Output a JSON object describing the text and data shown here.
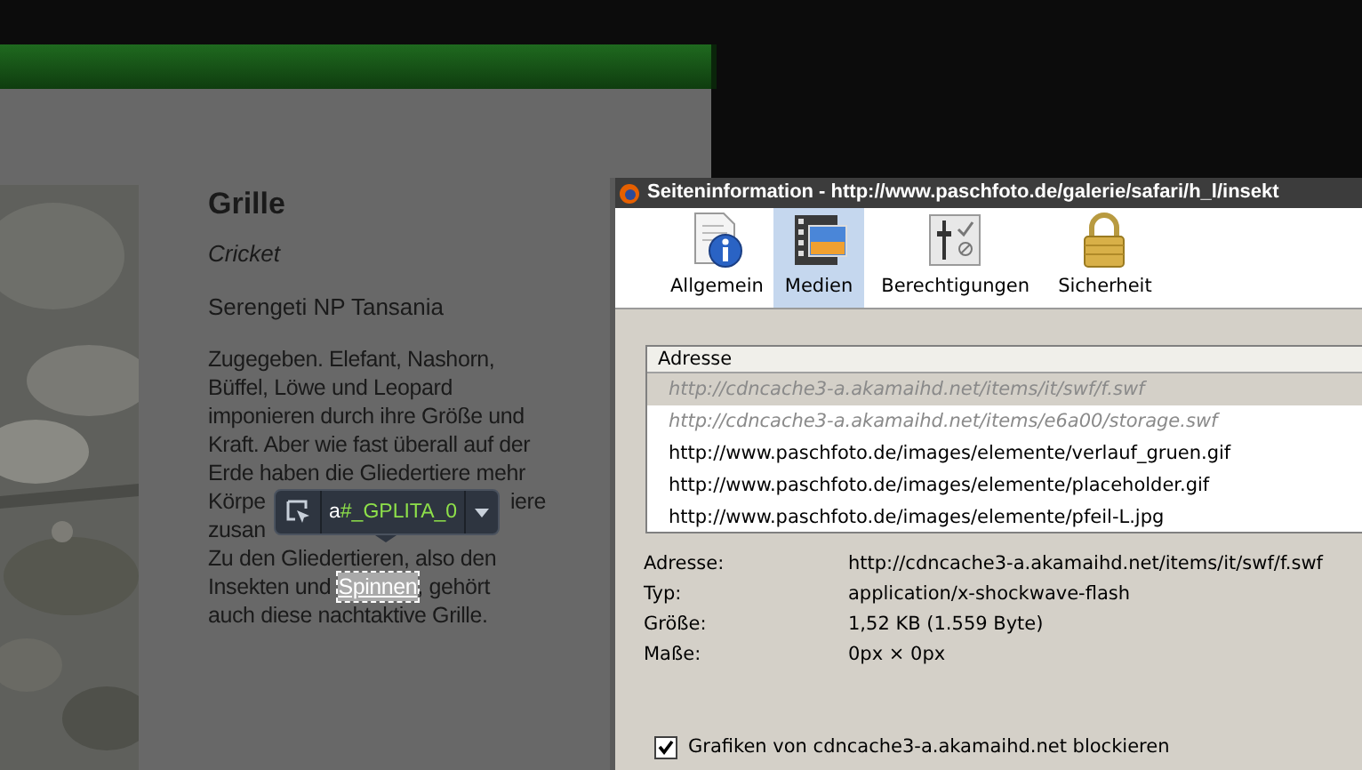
{
  "page": {
    "title": "Grille",
    "subtitle": "Cricket",
    "location": "Serengeti NP Tansania",
    "paragraph_lines": [
      [
        "Zugegeben. Elefant, Nashorn,"
      ],
      [
        "Büffel, Löwe und Leopard"
      ],
      [
        "imponieren durch ihre Größe und"
      ],
      [
        "Kraft. Aber wie fast überall auf der"
      ],
      [
        "Erde haben die Gliedertiere mehr"
      ],
      [
        "Körpe",
        "iere"
      ],
      [
        "zusan"
      ],
      [
        "Zu den Gliedertieren, also den"
      ]
    ],
    "link_line": {
      "before": "Insekten und",
      "link": "Spinnen",
      "after": ", gehört"
    },
    "last_line": "auch diese nachtaktive Grille.",
    "inspector_tooltip": {
      "tag": "a",
      "id": "#_GPLITA_0"
    }
  },
  "dialog": {
    "title": "Seiteninformation - http://www.paschfoto.de/galerie/safari/h_l/insekt",
    "tabs": [
      {
        "label": "Allgemein",
        "kind": "info",
        "selected": false
      },
      {
        "label": "Medien",
        "kind": "media",
        "selected": true
      },
      {
        "label": "Berechtigungen",
        "kind": "permissions",
        "selected": false
      },
      {
        "label": "Sicherheit",
        "kind": "lock",
        "selected": false
      }
    ],
    "list": {
      "column": "Adresse",
      "rows": [
        {
          "address": "http://cdncache3-a.akamaihd.net/items/it/swf/f.swf",
          "selected": true,
          "blocked": true
        },
        {
          "address": "http://cdncache3-a.akamaihd.net/items/e6a00/storage.swf",
          "selected": false,
          "blocked": true
        },
        {
          "address": "http://www.paschfoto.de/images/elemente/verlauf_gruen.gif",
          "selected": false,
          "blocked": false
        },
        {
          "address": "http://www.paschfoto.de/images/elemente/placeholder.gif",
          "selected": false,
          "blocked": false
        },
        {
          "address": "http://www.paschfoto.de/images/elemente/pfeil-L.jpg",
          "selected": false,
          "blocked": false
        }
      ]
    },
    "details": [
      {
        "label": "Adresse:",
        "value": "http://cdncache3-a.akamaihd.net/items/it/swf/f.swf"
      },
      {
        "label": "Typ:",
        "value": "application/x-shockwave-flash"
      },
      {
        "label": "Größe:",
        "value": "1,52 KB (1.559 Byte)"
      },
      {
        "label": "Maße:",
        "value": "0px × 0px"
      }
    ],
    "block_checkbox": {
      "label": "Grafiken von cdncache3-a.akamaihd.net blockieren",
      "checked": true
    }
  }
}
